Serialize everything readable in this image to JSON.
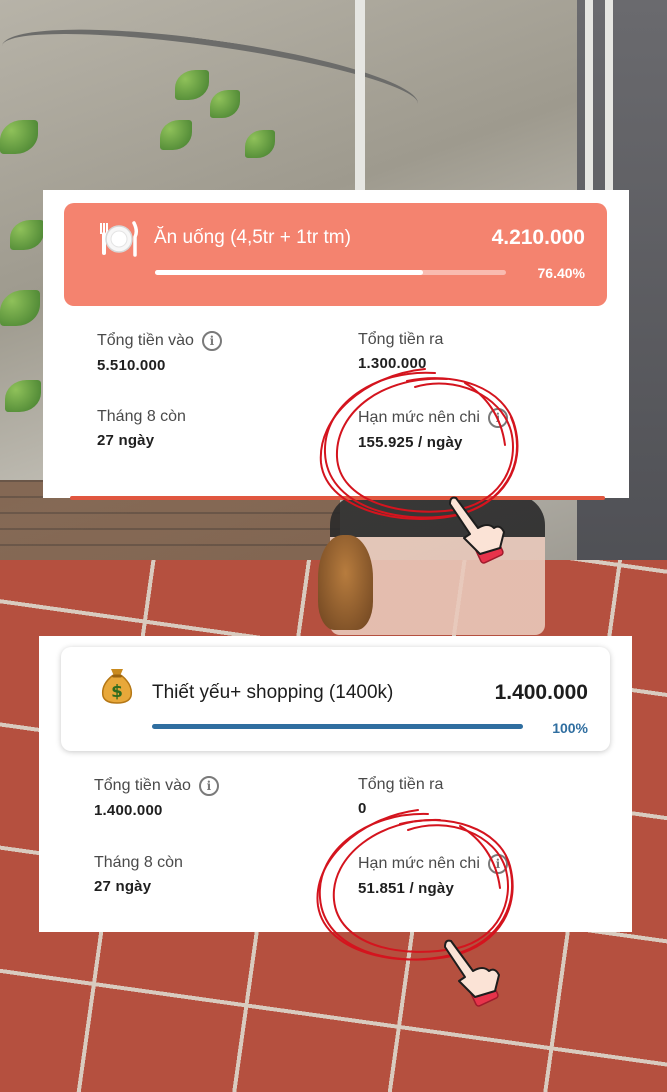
{
  "colors": {
    "accent_salmon": "#f4836f",
    "progress_blue": "#2f6ea0",
    "annotation_red": "#d4141e"
  },
  "cards": [
    {
      "icon": "plate-cutlery-icon",
      "name": "Ăn uống (4,5tr + 1tr tm)",
      "amount": "4.210.000",
      "progress_pct": 76.4,
      "progress_label": "76.40%",
      "stats": {
        "total_in_label": "Tổng tiền vào",
        "total_in_value": "5.510.000",
        "total_out_label": "Tổng tiền ra",
        "total_out_value": "1.300.000",
        "remaining_label": "Tháng 8 còn",
        "remaining_value": "27 ngày",
        "limit_label": "Hạn mức nên chi",
        "limit_value": "155.925 / ngày"
      }
    },
    {
      "icon": "money-bag-icon",
      "name": "Thiết yếu+ shopping (1400k)",
      "amount": "1.400.000",
      "progress_pct": 100,
      "progress_label": "100%",
      "stats": {
        "total_in_label": "Tổng tiền vào",
        "total_in_value": "1.400.000",
        "total_out_label": "Tổng tiền ra",
        "total_out_value": "0",
        "remaining_label": "Tháng 8 còn",
        "remaining_value": "27 ngày",
        "limit_label": "Hạn mức nên chi",
        "limit_value": "51.851 / ngày"
      }
    }
  ],
  "info_glyph": "i"
}
